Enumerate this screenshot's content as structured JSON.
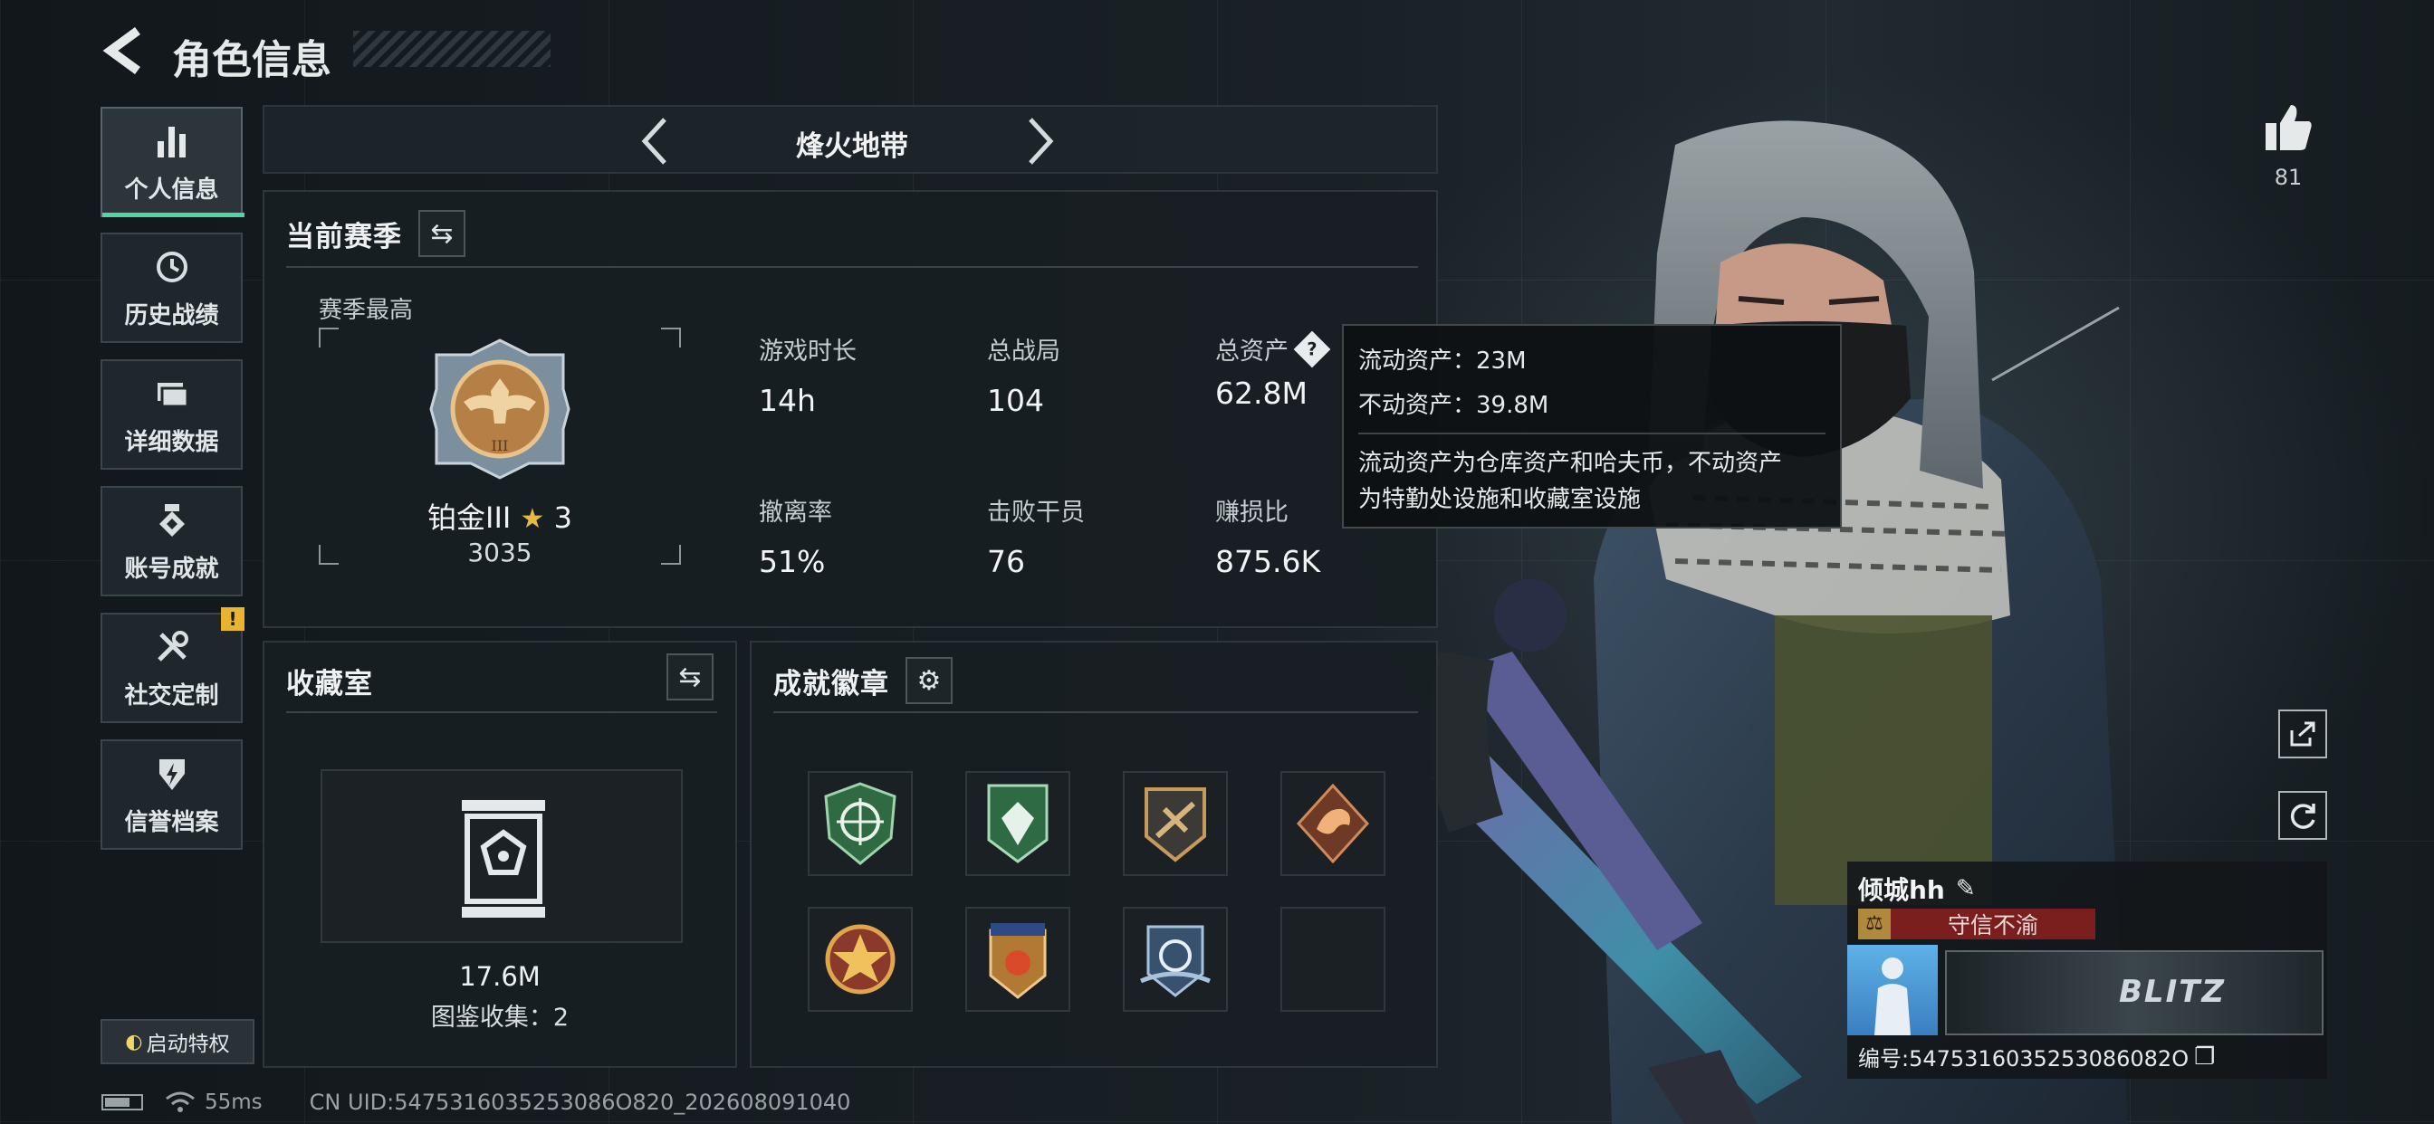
{
  "header": {
    "back_icon": "back-arrow-icon",
    "title": "角色信息"
  },
  "sidebar": {
    "items": [
      {
        "label": "个人信息",
        "icon": "bar-chart-icon",
        "active": true
      },
      {
        "label": "历史战绩",
        "icon": "clock-history-icon",
        "active": false
      },
      {
        "label": "详细数据",
        "icon": "folder-stack-icon",
        "active": false
      },
      {
        "label": "账号成就",
        "icon": "achievement-icon",
        "active": false
      },
      {
        "label": "社交定制",
        "icon": "wrench-tools-icon",
        "active": false,
        "alert": "!"
      },
      {
        "label": "信誉档案",
        "icon": "credit-shield-icon",
        "active": false
      }
    ],
    "privilege_button": "启动特权"
  },
  "mode_selector": {
    "label": "烽火地带"
  },
  "season": {
    "title": "当前赛季",
    "best_label": "赛季最高",
    "rank_name": "铂金III",
    "rank_stars": "3",
    "rank_score": "3035",
    "stats": [
      {
        "label": "游戏时长",
        "value": "14h"
      },
      {
        "label": "总战局",
        "value": "104"
      },
      {
        "label": "总资产",
        "value": "62.8M"
      },
      {
        "label": "撤离率",
        "value": "51%"
      },
      {
        "label": "击败干员",
        "value": "76"
      },
      {
        "label": "赚损比",
        "value": "875.6K"
      }
    ]
  },
  "tooltip": {
    "line1": "流动资产：23M",
    "line2": "不动资产：39.8M",
    "desc_line1": "流动资产为仓库资产和哈夫币，不动资产",
    "desc_line2": "为特勤处设施和收藏室设施"
  },
  "collection": {
    "title": "收藏室",
    "value": "17.6M",
    "count": "图鉴收集：2"
  },
  "achievements": {
    "title": "成就徽章",
    "badges": [
      {
        "icon": "green-crosshair-badge-icon",
        "color": "#2f6a43"
      },
      {
        "icon": "green-shield-badge-icon",
        "color": "#2e6b45"
      },
      {
        "icon": "bronze-rifle-badge-icon",
        "color": "#8a6a3c"
      },
      {
        "icon": "dragon-emblem-badge-icon",
        "color": "#9a4a2e"
      },
      {
        "icon": "star-medal-badge-icon",
        "color": "#9b3b2c"
      },
      {
        "icon": "stars-shield-badge-icon",
        "color": "#b07a34"
      },
      {
        "icon": "blue-wings-badge-icon",
        "color": "#38516e"
      },
      {
        "icon": "empty-slot",
        "color": "#1a2024"
      }
    ]
  },
  "likes": {
    "count": "81"
  },
  "player": {
    "name": "倾城hh",
    "reputation": "守信不渝",
    "id_text": "编号:5475316035253086082O",
    "banner_text": "BLITZ"
  },
  "footer": {
    "ping": "55ms",
    "uid": "CN UID:5475316035253086O820_202608091040"
  }
}
